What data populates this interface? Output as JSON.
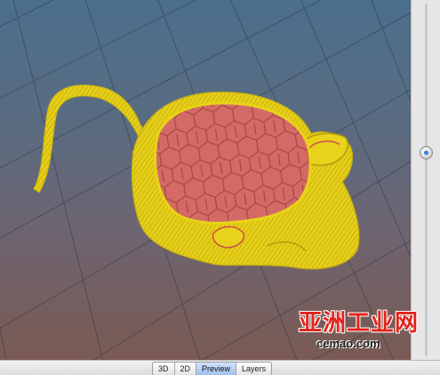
{
  "view_tabs": [
    {
      "label": "3D",
      "active": false
    },
    {
      "label": "2D",
      "active": false
    },
    {
      "label": "Preview",
      "active": true
    },
    {
      "label": "Layers",
      "active": false
    }
  ],
  "layer_slider": {
    "value": 0.58
  },
  "watermark": {
    "brand": "亚洲工业网",
    "url": "cemao.com"
  },
  "colors": {
    "model_shell": "#e8d21a",
    "model_infill": "#d8706c",
    "active_tab": "#9fc2ef"
  }
}
